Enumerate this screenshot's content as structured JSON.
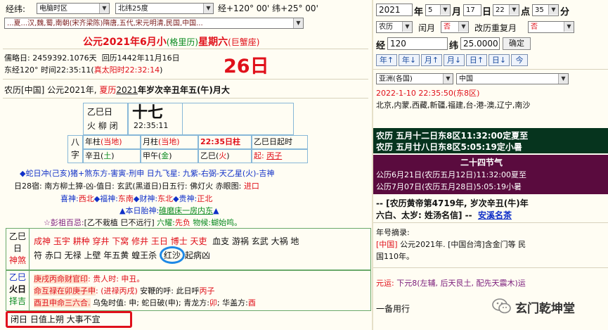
{
  "top": {
    "loc_label": "经纬:",
    "timezone": "电脑时区",
    "latitude_sel": "北纬25度",
    "coord_text": "经+120° 00' 纬+25° 00'",
    "dynasty_bar": "...夏...汉,魏,蜀,南朝(宋齐梁陈)隋唐,五代,宋元明清,民国,中国..."
  },
  "main": {
    "title_prefix": "公元2021年6月小",
    "title_mid": "(格里历)",
    "title_week": "星期六",
    "title_suffix": "(巨蟹座)",
    "julian": "儒略日: 2459392.1076天",
    "hijri": "回历1442年11月16日",
    "time_line_prefix": "东经120° 时间22:35:11(",
    "solar_time": "真太阳时22:32:14",
    "time_line_suffix": ")",
    "big_day": "26日",
    "lunar_line_a": "农历[中国] 公元2021年,",
    "lunar_line_b": "夏历",
    "lunar_line_c": "2021",
    "lunar_line_d": "年岁次辛丑年五(午)月大",
    "day_gz": "乙巳日",
    "day_small": "火 柳 闭",
    "lunar_big": "十七",
    "clock": "22:35:11",
    "bazi_label1": "八",
    "bazi_label2": "字",
    "pillars": [
      {
        "a": "年柱",
        "b": "(当地)",
        "c": "辛丑(",
        "d": "土",
        "e": ")"
      },
      {
        "a": "月柱",
        "b": "(当地)",
        "c": "甲午(",
        "d": "金",
        "e": ")"
      },
      {
        "a": "22:35日柱",
        "b": "",
        "c": "乙巳(",
        "d": "火",
        "e": ")"
      },
      {
        "a": "乙巳日起时",
        "b": "",
        "c": "起: ",
        "d": "丙子",
        "e": ""
      }
    ],
    "info1": "◆蛇日冲(己亥)猪+煞东方-害寅-刑申 日九飞星: 九紫-右弼-天乙星(火)-吉神",
    "info2a": "日28宿: 南方柳土獐-凶-值日: 玄武(黑道日)日五行: 佛灯火 赤眼图:",
    "info2b": "进口",
    "info3a": "喜神:",
    "info3b": "西北",
    "info3c": "◆福神:",
    "info3d": "东南",
    "info3e": "◆财神:",
    "info3f": "东北",
    "info3g": "◆贵神:",
    "info3h": "正北",
    "info4a": "▲本日胎神:",
    "info4b": "碓磨床一房内东",
    "info4c": "▲",
    "info5a": "☆彭祖百忌:",
    "info5b": "[乙不栽植 巳不远行]",
    "info5c": "六耀:",
    "info5d": "先负",
    "info5e": "物候:",
    "info5f": "蝴始鸣。",
    "shensha_label1": "乙巳",
    "shensha_label2": "日",
    "shensha_label3": "神煞",
    "shensha_red": "成神 玉宇 耕种 穿井 下窝 修井 王日 博士 天吏",
    "shensha_black1": "血支 游祸 玄武 大祸 地",
    "shensha_line2a": "符 赤口 无禄 上壁 年五黄 蝗王杀",
    "shensha_circled": "红沙",
    "shensha_line2b": "起病凶",
    "hour_label1": "乙巳",
    "hour_label2": "火日",
    "hour_label3": "择吉",
    "hour_l1a": "庚戌丙命财官印",
    "hour_l1b": ": 贵人时: 申丑。",
    "hour_l2a": "命互禄在卯庚子申",
    "hour_l2b": ": (进禄丙戌)",
    "hour_l2c": "安鞭的呼: 此日呼",
    "hour_l2d": "丙子",
    "hour_l3a": "酉丑申命三六合.",
    "hour_l3b": "乌兔时值: 申; 蛇日破(申); 青龙方:",
    "hour_l3c": "卯",
    "hour_l3d": "; 华盖方:",
    "hour_l3e": "酉",
    "bottom_note": "闭日 日值上朔 大事不宜"
  },
  "right": {
    "year": "2021",
    "year_lbl": "年",
    "month": "5",
    "month_lbl": "月",
    "day": "17",
    "day_lbl": "日",
    "hour": "22",
    "hour_lbl": "点",
    "minute": "35",
    "minute_lbl": "分",
    "cal_type": "农历",
    "leap_lbl": "闰月",
    "leap_val": "否",
    "change_lbl": "改历重复月",
    "change_val": "否",
    "lng_lbl": "经",
    "lng": "120",
    "lat_lbl": "纬",
    "lat": "25.0000",
    "ok": "确定",
    "nav": [
      "年↑",
      "年↓",
      "月↑",
      "月↓",
      "日↑",
      "日↓",
      "今"
    ],
    "region": "亚洲(各国)",
    "country": "中国",
    "cur_time": "2022-1-10 22:35:50(东8区)",
    "cities": "北京,内蒙,西藏,新疆,福建,台-港-澳,辽宁,南沙",
    "jq1": "农历 五月十二日东8区11:32:00定夏至",
    "jq2": "农历 五月廿八日东8区5:05:19定小暑",
    "jq_title": "二十四节气",
    "jq3": "公历6月21日(农历五月12日)11:32:00夏至",
    "jq4": "公历7月07日(农历五月28日)5:05:19小暑",
    "huangdi_a": "-- [农历黄帝第4719年, 岁次辛丑(牛)年",
    "huangdi_b": "六白、太岁: 姓汤名信] --",
    "huangdi_c": "安溪名茶",
    "nianhao_title": "年号摘录:",
    "nianhao_a": "[中国]",
    "nianhao_b": " 公元2021年. [中国台湾]含金门等 民",
    "nianhao_c": "国110年。",
    "yuanyun_a": "元运:",
    "yuanyun_b": " 下元8(左辅, 后天艮土, 配先天震木)运",
    "beiyong": "一备用行",
    "watermark": "玄门乾坤堂"
  },
  "colors": {
    "dark_green": "#06341e",
    "dark_purple": "#5a0b3e",
    "accent_red": "#e0101a",
    "accent_blue": "#1030c8",
    "circle_blue": "#1e88e5"
  }
}
